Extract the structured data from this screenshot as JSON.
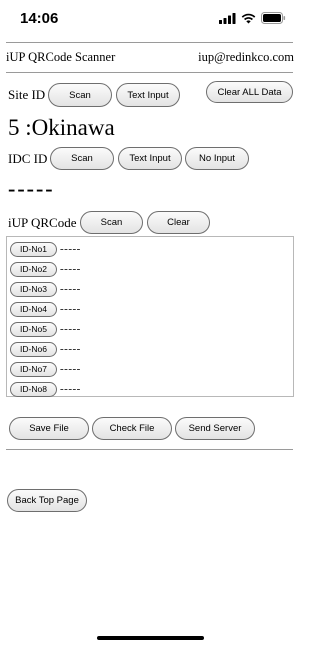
{
  "status_bar": {
    "time": "14:06"
  },
  "header": {
    "title": "iUP QRCode Scanner",
    "email": "iup@redinkco.com"
  },
  "site": {
    "label": "Site ID",
    "scan": "Scan",
    "text_input": "Text Input",
    "clear_all": "Clear ALL Data",
    "value": "5 :Okinawa"
  },
  "idc": {
    "label": "IDC ID",
    "scan": "Scan",
    "text_input": "Text Input",
    "no_input": "No Input",
    "value": "-----"
  },
  "qr": {
    "label": "iUP QRCode",
    "scan": "Scan",
    "clear": "Clear"
  },
  "id_list": [
    {
      "label": "ID-No1",
      "value": "-----"
    },
    {
      "label": "ID-No2",
      "value": "-----"
    },
    {
      "label": "ID-No3",
      "value": "-----"
    },
    {
      "label": "ID-No4",
      "value": "-----"
    },
    {
      "label": "ID-No5",
      "value": "-----"
    },
    {
      "label": "ID-No6",
      "value": "-----"
    },
    {
      "label": "ID-No7",
      "value": "-----"
    },
    {
      "label": "ID-No8",
      "value": "-----"
    }
  ],
  "actions": {
    "save_file": "Save File",
    "check_file": "Check File",
    "send_server": "Send Server"
  },
  "nav": {
    "back_top": "Back Top Page"
  }
}
